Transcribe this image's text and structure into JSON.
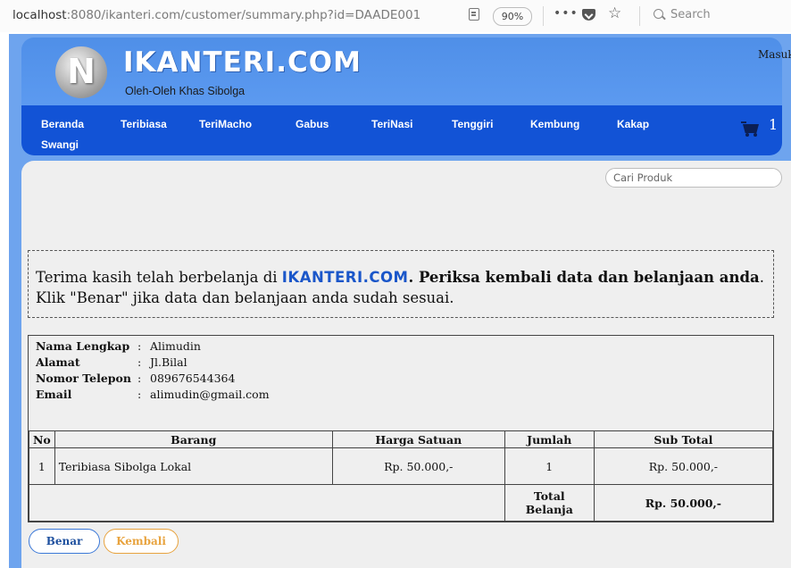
{
  "browser": {
    "url_host": "localhost",
    "url_rest": ":8080/ikanteri.com/customer/summary.php?id=DAADE001",
    "zoom": "90%",
    "menu_dots": "•••",
    "search_placeholder": "Search"
  },
  "site": {
    "brand": "IKANTERI.COM",
    "tagline": "Oleh-Oleh Khas Sibolga",
    "login_label": "Masuk",
    "logo_letter": "N"
  },
  "nav": {
    "items": [
      "Beranda",
      "Teribiasa",
      "TeriMacho",
      "Gabus",
      "TeriNasi",
      "Tenggiri",
      "Kembung",
      "Kakap",
      "Swangi"
    ],
    "cart_count": "1"
  },
  "search": {
    "placeholder": "Cari Produk"
  },
  "notice": {
    "prefix": "Terima kasih telah berbelanja di ",
    "brand": "IKANTERI.COM",
    "bold_text": ". Periksa kembali data dan belanjaan anda",
    "suffix": ".",
    "line2": "Klik \"Benar\" jika data dan belanjaan anda sudah sesuai."
  },
  "customer": {
    "fields": [
      {
        "label": "Nama Lengkap",
        "value": "Alimudin"
      },
      {
        "label": "Alamat",
        "value": "Jl.Bilal"
      },
      {
        "label": "Nomor Telepon",
        "value": "089676544364"
      },
      {
        "label": "Email",
        "value": "alimudin@gmail.com"
      }
    ],
    "separator": ":"
  },
  "order": {
    "headers": [
      "No",
      "Barang",
      "Harga Satuan",
      "Jumlah",
      "Sub Total"
    ],
    "rows": [
      {
        "no": "1",
        "item": "Teribiasa Sibolga Lokal",
        "price": "Rp. 50.000,-",
        "qty": "1",
        "subtotal": "Rp. 50.000,-"
      }
    ],
    "total_label": "Total Belanja",
    "total_value": "Rp. 50.000,-"
  },
  "actions": {
    "confirm_label": "Benar",
    "back_label": "Kembali"
  },
  "colors": {
    "header": "#5c9af0",
    "nav": "#1253d6",
    "content_bg": "#efefef",
    "confirm": "#3b78d8",
    "back": "#e8a33e"
  }
}
